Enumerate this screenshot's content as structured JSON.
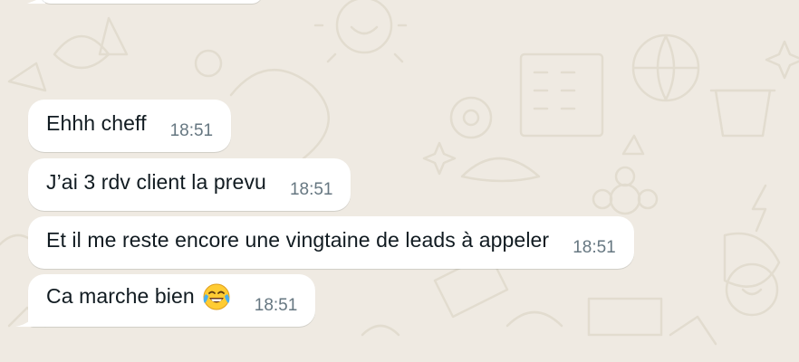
{
  "chat": {
    "messages": [
      {
        "text": "Ehhh cheff",
        "time": "18:51"
      },
      {
        "text": "J’ai 3 rdv client la prevu",
        "time": "18:51"
      },
      {
        "text": "Et il me reste encore une vingtaine de leads à appeler",
        "time": "18:51"
      },
      {
        "text": "Ca marche bien",
        "time": "18:51",
        "emoji": "face-with-tears-of-joy-icon"
      }
    ]
  },
  "colors": {
    "background": "#efeae2",
    "bubble": "#ffffff",
    "text": "#111b21",
    "timestamp": "#667781",
    "wallpaper_doodle": "#e2dccf"
  }
}
